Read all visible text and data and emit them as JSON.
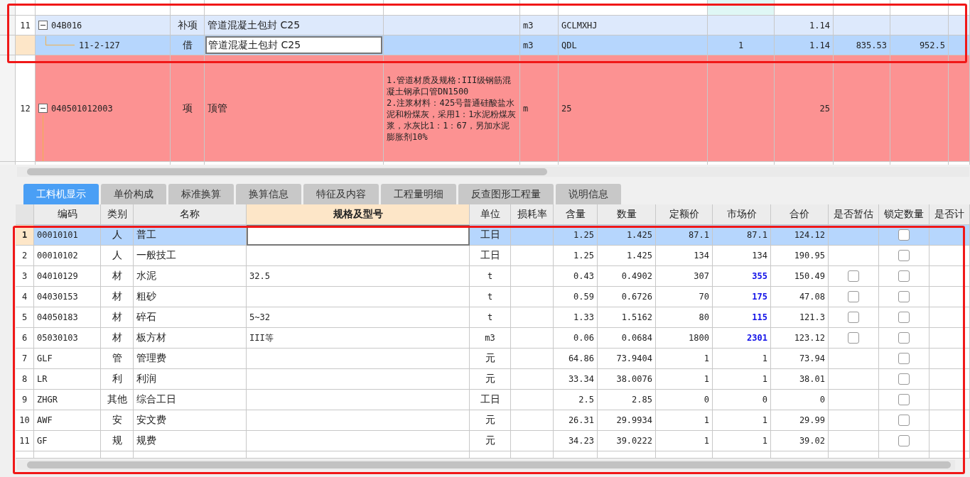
{
  "tree_grid": {
    "rows": [
      {
        "number": "11",
        "code": "04B016",
        "type": "补项",
        "name": "管道混凝土包封 C25",
        "unit": "m3",
        "column_6": "GCLMXHJ",
        "quantity": "1.14",
        "highlighted": true,
        "selected": false,
        "expanded": true,
        "children": [
          {
            "code": "11-2-127",
            "type": "借",
            "name": "管道混凝土包封 C25",
            "unit": "m3",
            "column_6": "QDL",
            "column_7": "1",
            "quantity": "1.14",
            "unit_price": "835.53",
            "total": "952.5",
            "selected": true
          }
        ]
      },
      {
        "number": "12",
        "code": "040501012003",
        "type": "项",
        "name": "顶管",
        "feature": "1.管道材质及规格:III级钢筋混凝土钢承口管DN1500\n2.注浆材料：425号普通硅酸盐水泥和粉煤灰，采用1：1水泥粉煤灰浆，水灰比1：1：67，另加水泥膨胀剂10%",
        "unit": "m",
        "column_6": "25",
        "quantity": "25",
        "error": true,
        "selected": false,
        "expanded": true
      }
    ]
  },
  "tabs": [
    {
      "label": "工料机显示",
      "selected": true
    },
    {
      "label": "单价构成",
      "selected": false
    },
    {
      "label": "标准换算",
      "selected": false
    },
    {
      "label": "换算信息",
      "selected": false
    },
    {
      "label": "特征及内容",
      "selected": false
    },
    {
      "label": "工程量明细",
      "selected": false
    },
    {
      "label": "反查图形工程量",
      "selected": false
    },
    {
      "label": "说明信息",
      "selected": false
    }
  ],
  "resource_table": {
    "columns": [
      {
        "label": "编码",
        "highlighted": false
      },
      {
        "label": "类别",
        "highlighted": false
      },
      {
        "label": "名称",
        "highlighted": false
      },
      {
        "label": "规格及型号",
        "highlighted": true
      },
      {
        "label": "单位",
        "highlighted": false
      },
      {
        "label": "损耗率",
        "highlighted": false
      },
      {
        "label": "含量",
        "highlighted": false
      },
      {
        "label": "数量",
        "highlighted": false
      },
      {
        "label": "定额价",
        "highlighted": false
      },
      {
        "label": "市场价",
        "highlighted": false
      },
      {
        "label": "合价",
        "highlighted": false
      },
      {
        "label": "是否暂估",
        "highlighted": false
      },
      {
        "label": "锁定数量",
        "highlighted": false
      },
      {
        "label": "是否计",
        "highlighted": false
      }
    ],
    "rows": [
      {
        "number": "1",
        "code": "00010101",
        "category": "人",
        "name": "普工",
        "spec": "",
        "unit": "工日",
        "content": "1.25",
        "amount": "1.425",
        "quota_price": "87.1",
        "market_price": "87.1",
        "total": "124.12",
        "price_adjusted": false,
        "locked": false,
        "selected": true
      },
      {
        "number": "2",
        "code": "00010102",
        "category": "人",
        "name": "一般技工",
        "unit": "工日",
        "content": "1.25",
        "amount": "1.425",
        "quota_price": "134",
        "market_price": "134",
        "total": "190.95",
        "price_adjusted": false,
        "locked": false,
        "selected": false
      },
      {
        "number": "3",
        "code": "04010129",
        "category": "材",
        "name": "水泥",
        "spec": "32.5",
        "unit": "t",
        "content": "0.43",
        "amount": "0.4902",
        "quota_price": "307",
        "market_price": "355",
        "total": "150.49",
        "price_adjusted": true,
        "provisional": false,
        "locked": false,
        "selected": false
      },
      {
        "number": "4",
        "code": "04030153",
        "category": "材",
        "name": "粗砂",
        "unit": "t",
        "content": "0.59",
        "amount": "0.6726",
        "quota_price": "70",
        "market_price": "175",
        "total": "47.08",
        "price_adjusted": true,
        "provisional": false,
        "locked": false,
        "selected": false
      },
      {
        "number": "5",
        "code": "04050183",
        "category": "材",
        "name": "碎石",
        "spec": "5~32",
        "unit": "t",
        "content": "1.33",
        "amount": "1.5162",
        "quota_price": "80",
        "market_price": "115",
        "total": "121.3",
        "price_adjusted": true,
        "provisional": false,
        "locked": false,
        "selected": false
      },
      {
        "number": "6",
        "code": "05030103",
        "category": "材",
        "name": "板方材",
        "spec": "III等",
        "unit": "m3",
        "content": "0.06",
        "amount": "0.0684",
        "quota_price": "1800",
        "market_price": "2301",
        "total": "123.12",
        "price_adjusted": true,
        "provisional": false,
        "locked": false,
        "selected": false
      },
      {
        "number": "7",
        "code": "GLF",
        "category": "管",
        "name": "管理费",
        "unit": "元",
        "content": "64.86",
        "amount": "73.9404",
        "quota_price": "1",
        "market_price": "1",
        "total": "73.94",
        "price_adjusted": false,
        "locked": false,
        "selected": false
      },
      {
        "number": "8",
        "code": "LR",
        "category": "利",
        "name": "利润",
        "unit": "元",
        "content": "33.34",
        "amount": "38.0076",
        "quota_price": "1",
        "market_price": "1",
        "total": "38.01",
        "price_adjusted": false,
        "locked": false,
        "selected": false
      },
      {
        "number": "9",
        "code": "ZHGR",
        "category": "其他",
        "name": "综合工日",
        "unit": "工日",
        "content": "2.5",
        "amount": "2.85",
        "quota_price": "0",
        "market_price": "0",
        "total": "0",
        "price_adjusted": false,
        "locked": false,
        "selected": false
      },
      {
        "number": "10",
        "code": "AWF",
        "category": "安",
        "name": "安文费",
        "unit": "元",
        "content": "26.31",
        "amount": "29.9934",
        "quota_price": "1",
        "market_price": "1",
        "total": "29.99",
        "price_adjusted": false,
        "locked": false,
        "selected": false
      },
      {
        "number": "11",
        "code": "GF",
        "category": "规",
        "name": "规费",
        "unit": "元",
        "content": "34.23",
        "amount": "39.0222",
        "quota_price": "1",
        "market_price": "1",
        "total": "39.02",
        "price_adjusted": false,
        "locked": false,
        "selected": false
      }
    ]
  }
}
